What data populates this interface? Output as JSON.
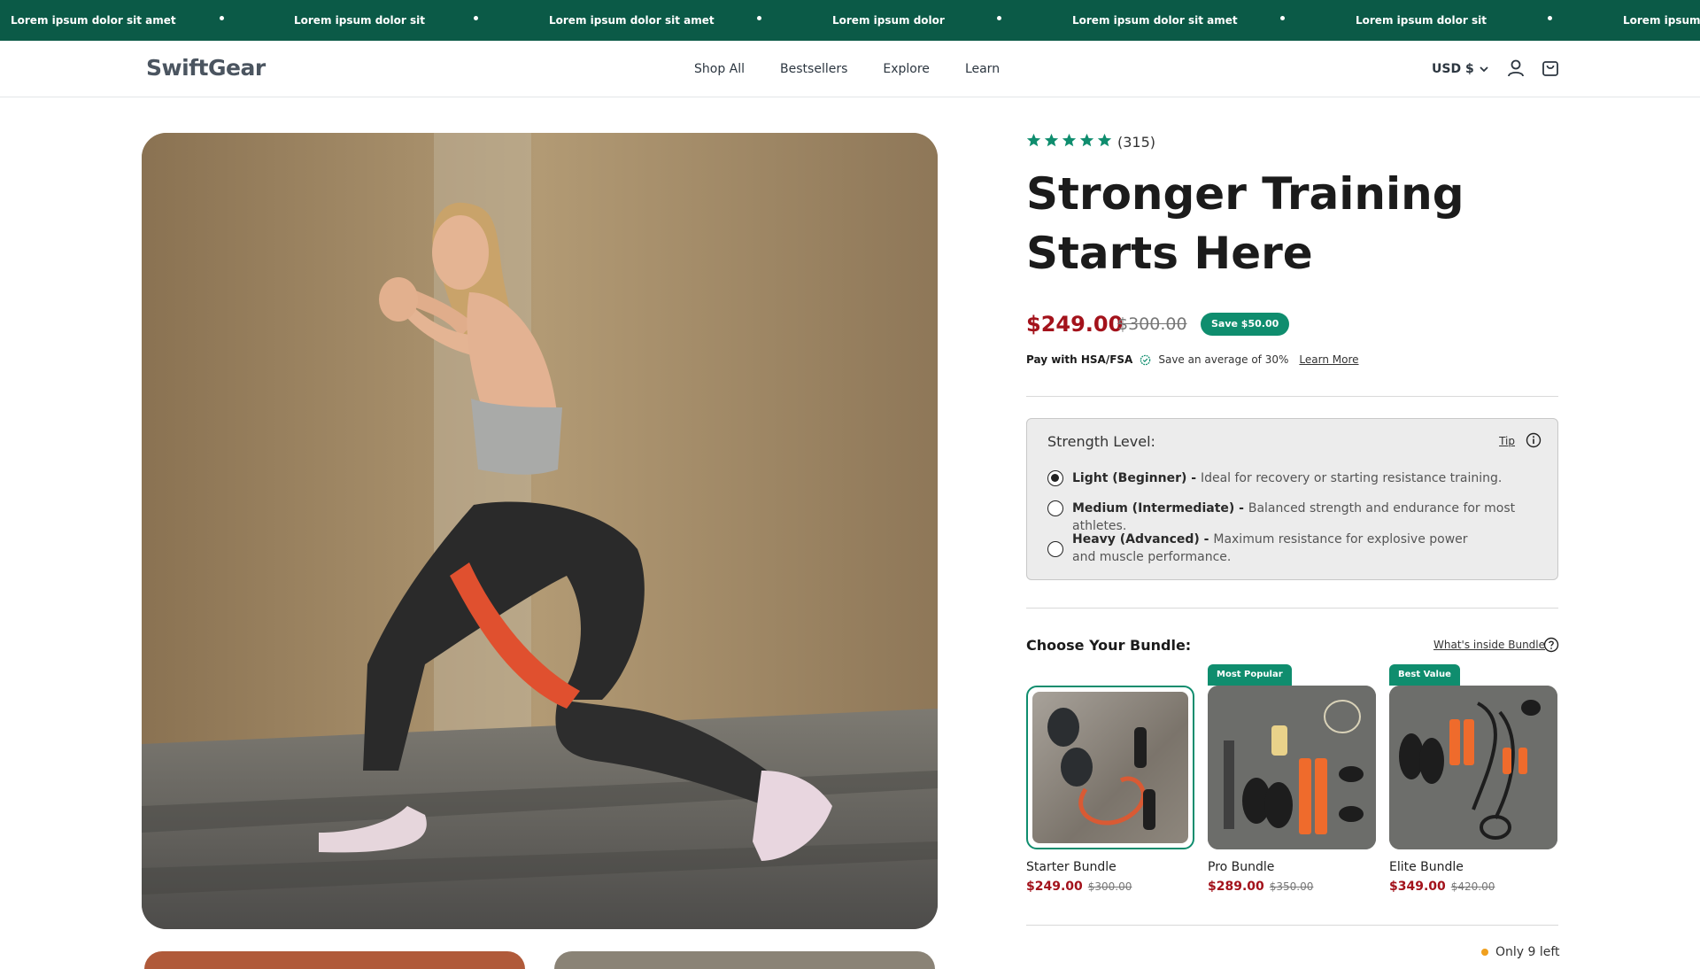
{
  "announcement": {
    "messages": [
      "Lorem ipsum dolor sit amet",
      "Lorem ipsum dolor sit",
      "Lorem ipsum dolor sit amet",
      "Lorem ipsum dolor",
      "Lorem ipsum dolor sit amet",
      "Lorem ipsum dolor sit",
      "Lorem ipsum d"
    ]
  },
  "header": {
    "logo": "SwiftGear",
    "nav": [
      "Shop All",
      "Bestsellers",
      "Explore",
      "Learn"
    ],
    "currency": "USD $",
    "icons": [
      "account-icon",
      "cart-icon",
      "chevron-down-icon"
    ]
  },
  "product": {
    "rating_stars": 5,
    "review_count": "(315)",
    "title": "Stronger Training Starts Here",
    "price": "$249.00",
    "compare_price": "$300.00",
    "save_badge": "Save $50.00",
    "hsa": {
      "label": "Pay with HSA/FSA",
      "text": "Save an average of 30%",
      "link": "Learn More"
    }
  },
  "strength": {
    "title": "Strength Level:",
    "tip": "Tip",
    "options": [
      {
        "name": "Light (Beginner)",
        "sep": " - ",
        "desc": "Ideal for recovery or starting resistance training.",
        "selected": true
      },
      {
        "name": "Medium (Intermediate)",
        "sep": " - ",
        "desc": "Balanced strength and endurance for most athletes.",
        "selected": false
      },
      {
        "name": "Heavy (Advanced)",
        "sep": " - ",
        "desc": "Maximum resistance for explosive power and muscle performance.",
        "selected": false
      }
    ]
  },
  "bundles": {
    "heading": "Choose Your Bundle:",
    "link": "What's inside Bundle",
    "items": [
      {
        "name": "Starter Bundle",
        "price": "$249.00",
        "compare": "$300.00",
        "tag": "",
        "selected": true
      },
      {
        "name": "Pro Bundle",
        "price": "$289.00",
        "compare": "$350.00",
        "tag": "Most Popular",
        "selected": false
      },
      {
        "name": "Elite Bundle",
        "price": "$349.00",
        "compare": "$420.00",
        "tag": "Best Value",
        "selected": false
      }
    ]
  },
  "stock": {
    "text": "Only 9 left"
  },
  "colors": {
    "brand": "#0b5a47",
    "accent": "#0f8d6e",
    "price": "#a3121b",
    "star": "#0f8d6e",
    "stock_dot": "#f0a01e"
  }
}
